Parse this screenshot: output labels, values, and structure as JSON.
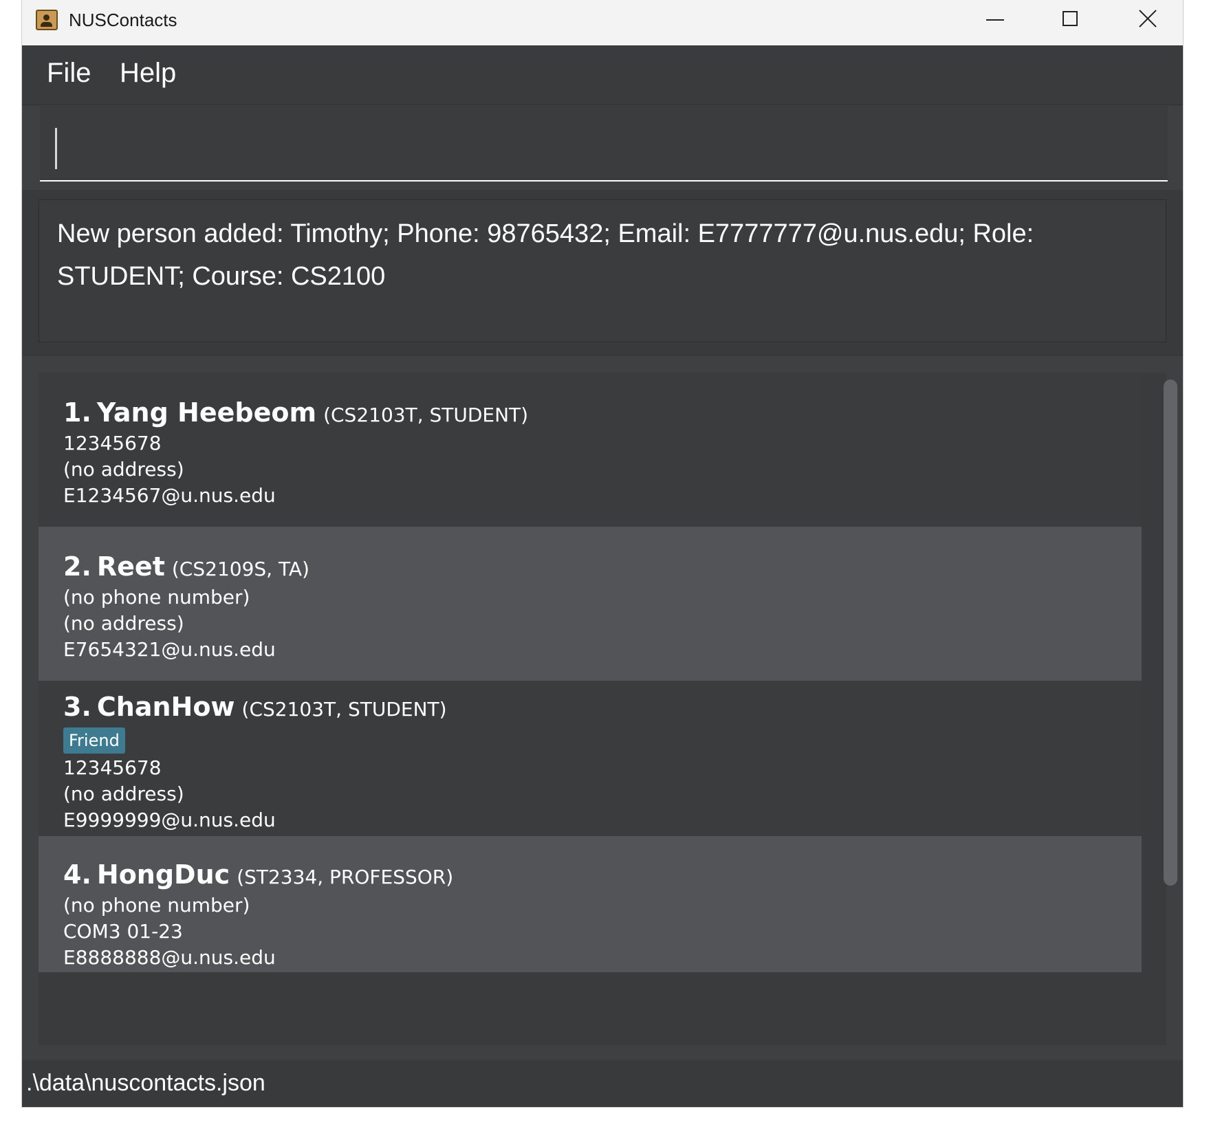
{
  "window": {
    "title": "NUSContacts",
    "app_icon": "contacts-book-icon",
    "controls": {
      "minimize": "minimize-icon",
      "maximize": "maximize-icon",
      "close": "close-icon"
    }
  },
  "menu": {
    "file": "File",
    "help": "Help"
  },
  "command_input": {
    "value": "",
    "placeholder": ""
  },
  "result": {
    "line1": "New person added: Timothy; Phone: 98765432; Email: E7777777@u.nus.edu; Role:",
    "line2": "STUDENT; Course: CS2100"
  },
  "persons": [
    {
      "index": "1.",
      "name": "Yang Heebeom",
      "meta": "(CS2103T, STUDENT)",
      "tags": [],
      "phone": "12345678",
      "address": "(no address)",
      "email": "E1234567@u.nus.edu"
    },
    {
      "index": "2.",
      "name": "Reet",
      "meta": "(CS2109S, TA)",
      "tags": [],
      "phone": "(no phone number)",
      "address": "(no address)",
      "email": "E7654321@u.nus.edu"
    },
    {
      "index": "3.",
      "name": "ChanHow",
      "meta": "(CS2103T, STUDENT)",
      "tags": [
        "Friend"
      ],
      "phone": "12345678",
      "address": "(no address)",
      "email": "E9999999@u.nus.edu"
    },
    {
      "index": "4.",
      "name": "HongDuc",
      "meta": "(ST2334, PROFESSOR)",
      "tags": [],
      "phone": "(no phone number)",
      "address": "COM3 01-23",
      "email": "E8888888@u.nus.edu"
    }
  ],
  "status": {
    "file_path": ".\\data\\nuscontacts.json"
  },
  "colors": {
    "background": "#3f4042",
    "card_dark": "#3b3c3e",
    "card_light": "#525457",
    "tag": "#3e7b91",
    "titlebar": "#f3f3f3"
  }
}
